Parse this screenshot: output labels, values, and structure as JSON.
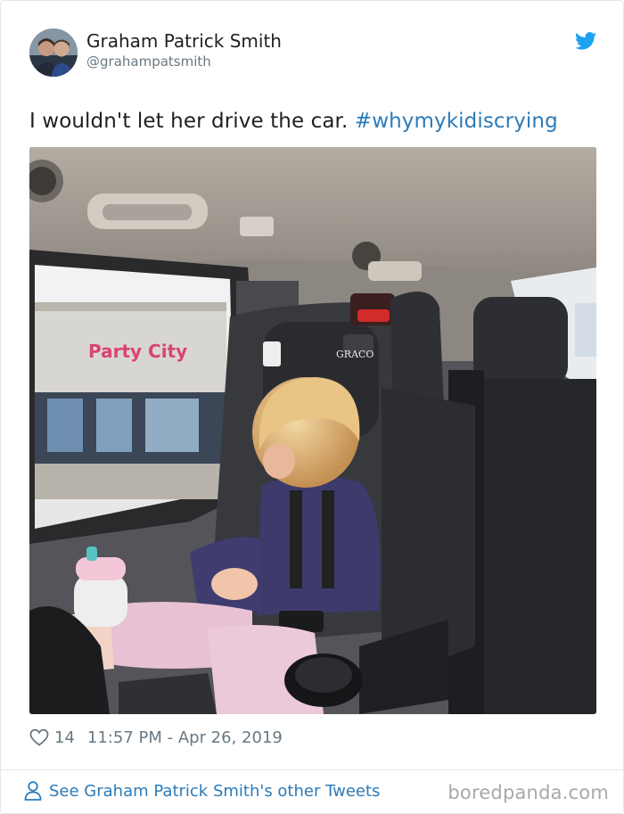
{
  "tweet": {
    "author_name": "Graham Patrick Smith",
    "author_handle": "@grahampatsmith",
    "text_plain": "I wouldn't let her drive the car. ",
    "hashtag": "#whymykidiscrying",
    "likes": "14",
    "timestamp": "11:57 PM - Apr 26, 2019",
    "photo_sign_text": "Party City",
    "photo_seat_brand": "GRACO"
  },
  "footer": {
    "see_more_label": "See Graham Patrick Smith's other Tweets",
    "watermark": "boredpanda.com"
  },
  "colors": {
    "link": "#2b7bb9",
    "text": "#1c2022",
    "muted": "#697882",
    "twitter_blue": "#1da1f2"
  },
  "icons": [
    "twitter-bird-icon",
    "heart-icon",
    "person-icon"
  ]
}
